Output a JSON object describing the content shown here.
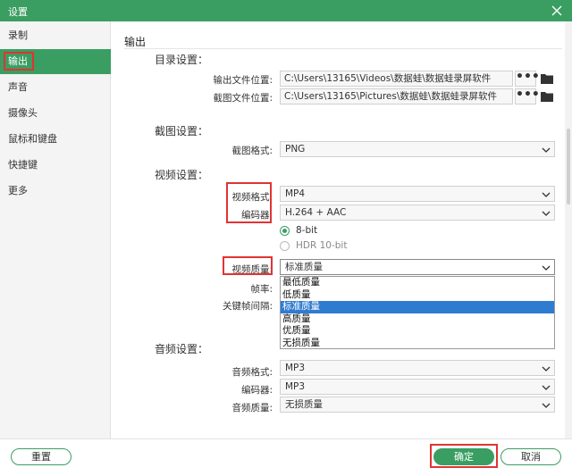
{
  "window": {
    "title": "设置"
  },
  "sidebar": {
    "items": [
      {
        "label": "录制"
      },
      {
        "label": "输出"
      },
      {
        "label": "声音"
      },
      {
        "label": "摄像头"
      },
      {
        "label": "鼠标和键盘"
      },
      {
        "label": "快捷键"
      },
      {
        "label": "更多"
      }
    ],
    "active": "输出"
  },
  "main": {
    "section_title": "输出",
    "directory": {
      "heading": "目录设置：",
      "output_label": "输出文件位置:",
      "output_path": "C:\\Users\\13165\\Videos\\数据蛙\\数据蛙录屏软件",
      "screenshot_label": "截图文件位置:",
      "screenshot_path": "C:\\Users\\13165\\Pictures\\数据蛙\\数据蛙录屏软件",
      "browse_label": "•••"
    },
    "screenshot": {
      "heading": "截图设置：",
      "format_label": "截图格式:",
      "format_value": "PNG"
    },
    "video": {
      "heading": "视频设置：",
      "format_label": "视频格式:",
      "format_value": "MP4",
      "encoder_label": "编码器:",
      "encoder_value": "H.264 + AAC",
      "bit_options": [
        {
          "label": "8-bit",
          "selected": true
        },
        {
          "label": "HDR 10-bit",
          "selected": false
        }
      ],
      "quality_label": "视频质量:",
      "quality_value": "标准质量",
      "quality_options": [
        "最低质量",
        "低质量",
        "标准质量",
        "高质量",
        "优质量",
        "无损质量"
      ],
      "quality_selected_index": 2,
      "framerate_label": "帧率:",
      "keyframe_label": "关键帧间隔:"
    },
    "audio": {
      "heading": "音频设置：",
      "format_label": "音频格式:",
      "format_value": "MP3",
      "encoder_label": "编码器:",
      "encoder_value": "MP3",
      "quality_label": "音频质量:",
      "quality_value": "无损质量"
    }
  },
  "footer": {
    "reset_label": "重置",
    "ok_label": "确定",
    "cancel_label": "取消"
  },
  "colors": {
    "brand_green": "#3a9e62",
    "selection_blue": "#2f7bd0",
    "annotation_red": "#e23333"
  }
}
